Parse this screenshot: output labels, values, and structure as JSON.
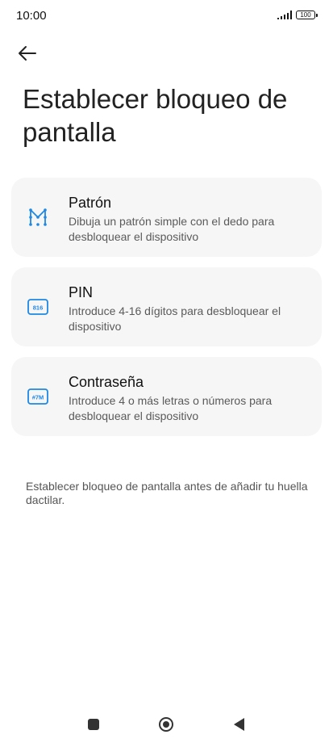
{
  "status_bar": {
    "time": "10:00",
    "battery": "100"
  },
  "header": {
    "title": "Establecer bloqueo de pantalla"
  },
  "options": [
    {
      "title": "Patrón",
      "description": "Dibuja un patrón simple con el dedo para desbloquear el dispositivo",
      "icon": "pattern-icon"
    },
    {
      "title": "PIN",
      "description": "Introduce 4-16 dígitos para desbloquear el dispositivo",
      "icon": "pin-icon",
      "icon_text": "816"
    },
    {
      "title": "Contraseña",
      "description": "Introduce 4 o más letras o números para desbloquear el dispositivo",
      "icon": "password-icon",
      "icon_text": "#7M"
    }
  ],
  "hint": "Establecer bloqueo de pantalla antes de añadir tu huella dactilar.",
  "colors": {
    "accent": "#1e88e5",
    "card_background": "#f6f6f6"
  }
}
